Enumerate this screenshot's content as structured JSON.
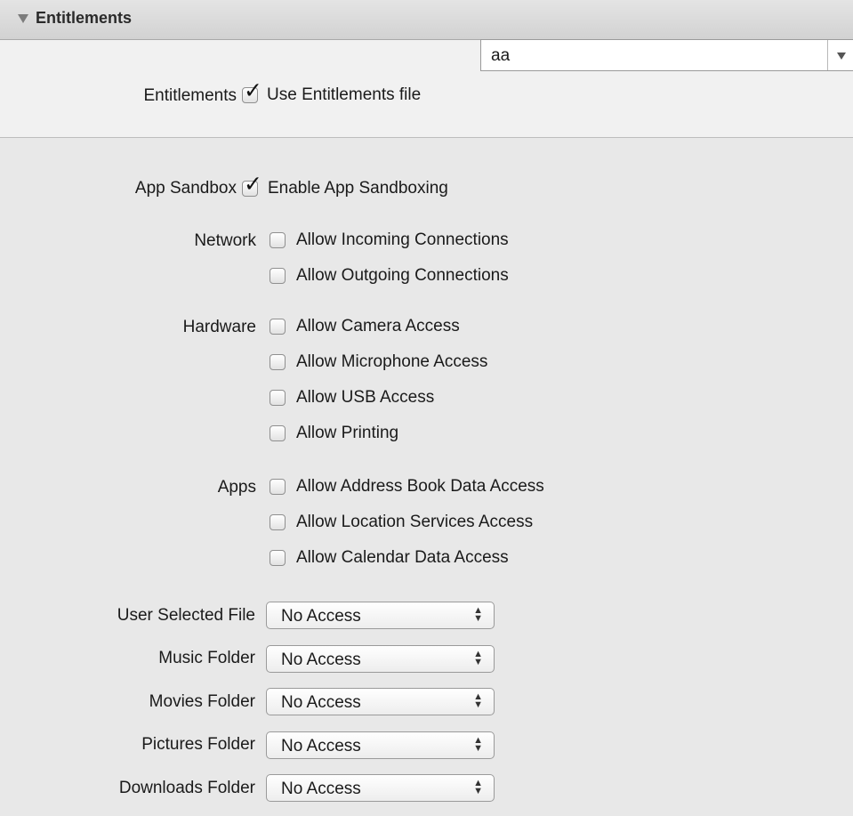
{
  "section": {
    "title": "Entitlements"
  },
  "entitlements": {
    "label": "Entitlements",
    "use_file_label": "Use Entitlements file",
    "use_file_checked": true,
    "file_value": "aa"
  },
  "sandbox": {
    "label": "App Sandbox",
    "enable_label": "Enable App Sandboxing",
    "enable_checked": true
  },
  "network": {
    "label": "Network",
    "options": [
      {
        "label": "Allow Incoming Connections",
        "checked": false
      },
      {
        "label": "Allow Outgoing Connections",
        "checked": false
      }
    ]
  },
  "hardware": {
    "label": "Hardware",
    "options": [
      {
        "label": "Allow Camera Access",
        "checked": false
      },
      {
        "label": "Allow Microphone Access",
        "checked": false
      },
      {
        "label": "Allow USB Access",
        "checked": false
      },
      {
        "label": "Allow Printing",
        "checked": false
      }
    ]
  },
  "apps": {
    "label": "Apps",
    "options": [
      {
        "label": "Allow Address Book Data Access",
        "checked": false
      },
      {
        "label": "Allow Location Services Access",
        "checked": false
      },
      {
        "label": "Allow Calendar Data Access",
        "checked": false
      }
    ]
  },
  "folders": [
    {
      "label": "User Selected File",
      "value": "No Access"
    },
    {
      "label": "Music Folder",
      "value": "No Access"
    },
    {
      "label": "Movies Folder",
      "value": "No Access"
    },
    {
      "label": "Pictures Folder",
      "value": "No Access"
    },
    {
      "label": "Downloads Folder",
      "value": "No Access"
    }
  ]
}
